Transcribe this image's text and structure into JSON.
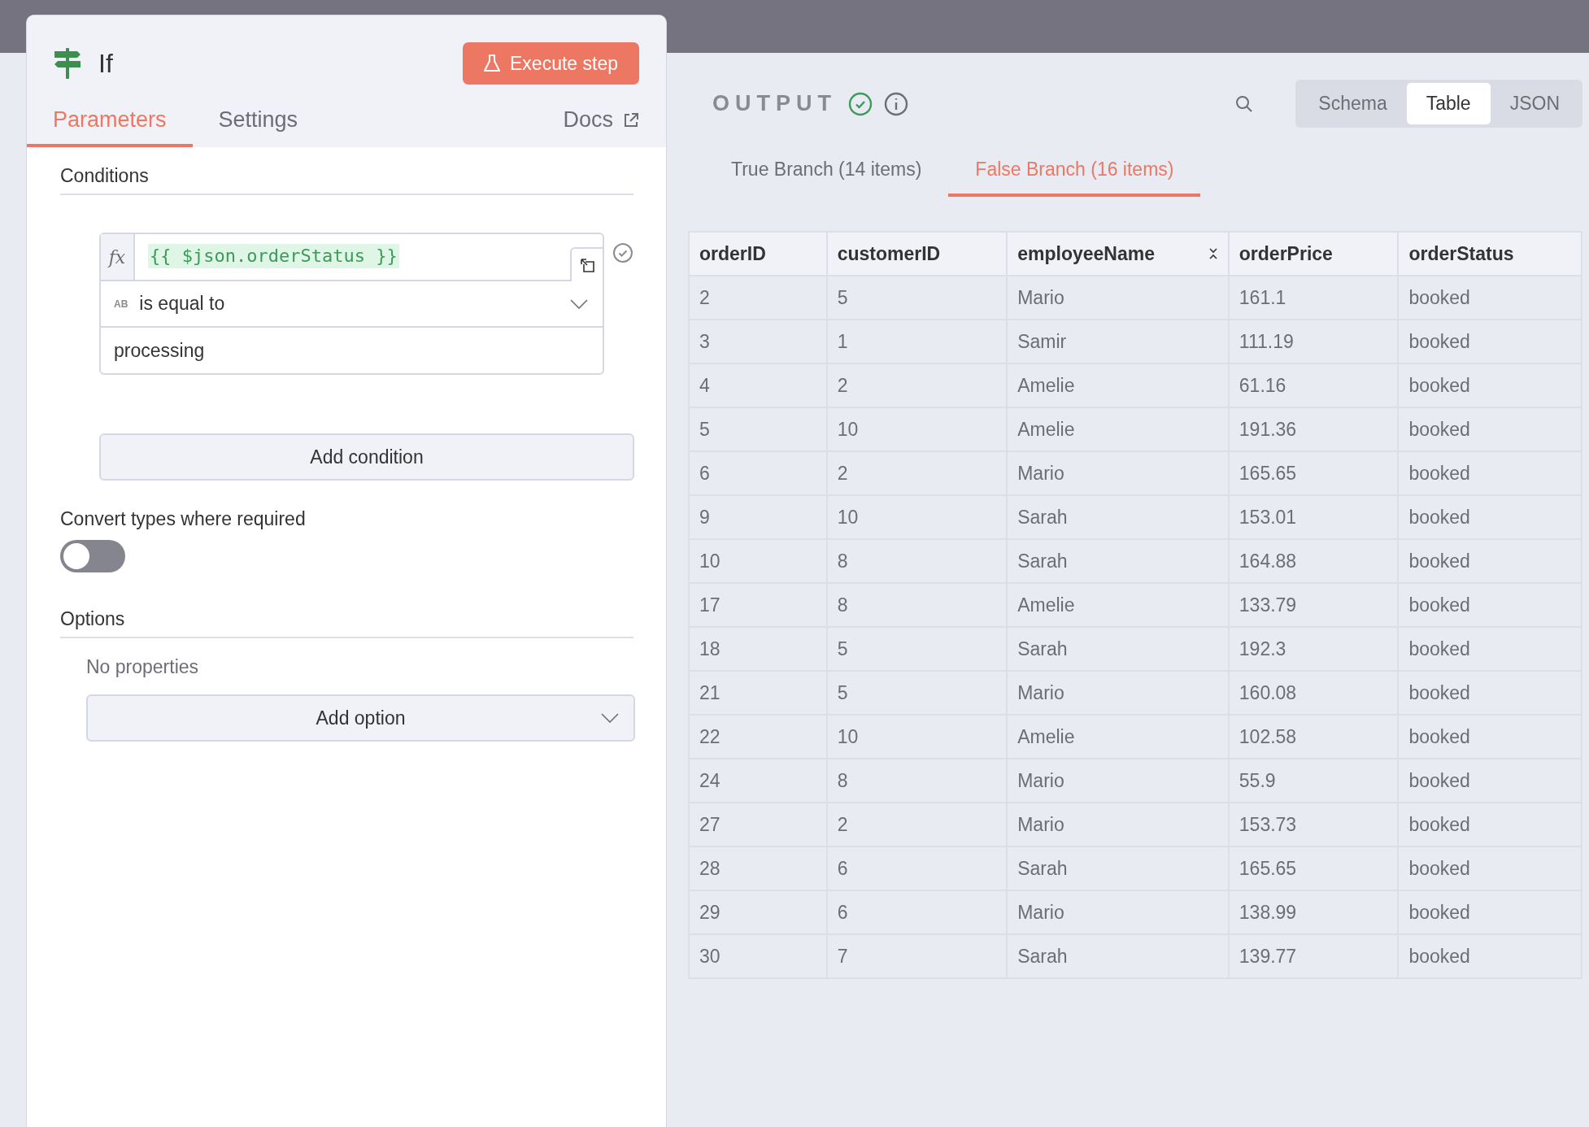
{
  "node": {
    "title": "If",
    "execute_button": "Execute step"
  },
  "panel_tabs": [
    {
      "label": "Parameters",
      "selected": true
    },
    {
      "label": "Settings",
      "selected": false
    }
  ],
  "docs_link": "Docs",
  "conditions": {
    "heading": "Conditions",
    "expression_prefix": "fx",
    "left_value": "{{ $json.orderStatus }}",
    "type_badge": "AB",
    "operator": "is equal to",
    "right_value": "processing",
    "add_button": "Add condition"
  },
  "convert_types": {
    "label": "Convert types where required",
    "on": false
  },
  "options": {
    "heading": "Options",
    "empty_text": "No properties",
    "add_button": "Add option"
  },
  "output": {
    "title": "OUTPUT",
    "views": [
      {
        "label": "Schema",
        "selected": false
      },
      {
        "label": "Table",
        "selected": true
      },
      {
        "label": "JSON",
        "selected": false
      }
    ],
    "branches": [
      {
        "label": "True Branch (14 items)",
        "selected": false
      },
      {
        "label": "False Branch (16 items)",
        "selected": true
      }
    ],
    "table": {
      "columns": [
        "orderID",
        "customerID",
        "employeeName",
        "orderPrice",
        "orderStatus"
      ],
      "rows": [
        [
          "2",
          "5",
          "Mario",
          "161.1",
          "booked"
        ],
        [
          "3",
          "1",
          "Samir",
          "111.19",
          "booked"
        ],
        [
          "4",
          "2",
          "Amelie",
          "61.16",
          "booked"
        ],
        [
          "5",
          "10",
          "Amelie",
          "191.36",
          "booked"
        ],
        [
          "6",
          "2",
          "Mario",
          "165.65",
          "booked"
        ],
        [
          "9",
          "10",
          "Sarah",
          "153.01",
          "booked"
        ],
        [
          "10",
          "8",
          "Sarah",
          "164.88",
          "booked"
        ],
        [
          "17",
          "8",
          "Amelie",
          "133.79",
          "booked"
        ],
        [
          "18",
          "5",
          "Sarah",
          "192.3",
          "booked"
        ],
        [
          "21",
          "5",
          "Mario",
          "160.08",
          "booked"
        ],
        [
          "22",
          "10",
          "Amelie",
          "102.58",
          "booked"
        ],
        [
          "24",
          "8",
          "Mario",
          "55.9",
          "booked"
        ],
        [
          "27",
          "2",
          "Mario",
          "153.73",
          "booked"
        ],
        [
          "28",
          "6",
          "Sarah",
          "165.65",
          "booked"
        ],
        [
          "29",
          "6",
          "Mario",
          "138.99",
          "booked"
        ],
        [
          "30",
          "7",
          "Sarah",
          "139.77",
          "booked"
        ]
      ]
    }
  }
}
